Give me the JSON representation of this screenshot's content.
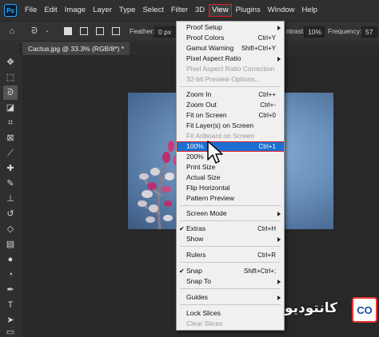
{
  "app": {
    "logo": "Ps"
  },
  "menubar": {
    "items": [
      "File",
      "Edit",
      "Image",
      "Layer",
      "Type",
      "Select",
      "Filter",
      "3D",
      "View",
      "Plugins",
      "Window",
      "Help"
    ],
    "active": "View"
  },
  "options": {
    "feather_label": "Feather:",
    "feather_value": "0 px",
    "contrast_label": "ntrast:",
    "contrast_value": "10%",
    "frequency_label": "Frequency:",
    "frequency_value": "57"
  },
  "document": {
    "tab_title": "Cactus.jpg @ 33.3% (RGB/8*) *"
  },
  "view_menu": {
    "items": [
      {
        "label": "Proof Setup",
        "submenu": true
      },
      {
        "label": "Proof Colors",
        "shortcut": "Ctrl+Y"
      },
      {
        "label": "Gamut Warning",
        "shortcut": "Shift+Ctrl+Y"
      },
      {
        "label": "Pixel Aspect Ratio",
        "submenu": true
      },
      {
        "label": "Pixel Aspect Ratio Correction",
        "disabled": true
      },
      {
        "label": "32-bit Preview Options...",
        "disabled": true
      },
      {
        "label": "Zoom In",
        "shortcut": "Ctrl++"
      },
      {
        "label": "Zoom Out",
        "shortcut": "Ctrl+-"
      },
      {
        "label": "Fit on Screen",
        "shortcut": "Ctrl+0"
      },
      {
        "label": "Fit Layer(s) on Screen"
      },
      {
        "label": "Fit Artboard on Screen",
        "disabled": true
      },
      {
        "label": "100%",
        "shortcut": "Ctrl+1",
        "highlighted": true
      },
      {
        "label": "200%"
      },
      {
        "label": "Print Size"
      },
      {
        "label": "Actual Size"
      },
      {
        "label": "Flip Horizontal"
      },
      {
        "label": "Pattern Preview"
      },
      {
        "label": "Screen Mode",
        "submenu": true
      },
      {
        "label": "Extras",
        "shortcut": "Ctrl+H",
        "checked": true
      },
      {
        "label": "Show",
        "submenu": true
      },
      {
        "label": "Rulers",
        "shortcut": "Ctrl+R"
      },
      {
        "label": "Snap",
        "shortcut": "Shift+Ctrl+;",
        "checked": true
      },
      {
        "label": "Snap To",
        "submenu": true
      },
      {
        "label": "Guides",
        "submenu": true
      },
      {
        "label": "Lock Slices"
      },
      {
        "label": "Clear Slices",
        "disabled": true
      }
    ]
  },
  "watermark": {
    "text": "کانتودیو",
    "logo": "CO"
  },
  "colors": {
    "highlight": "#1c6fd1",
    "callout": "#e0202a",
    "menu_bg": "#f0f0f0"
  }
}
